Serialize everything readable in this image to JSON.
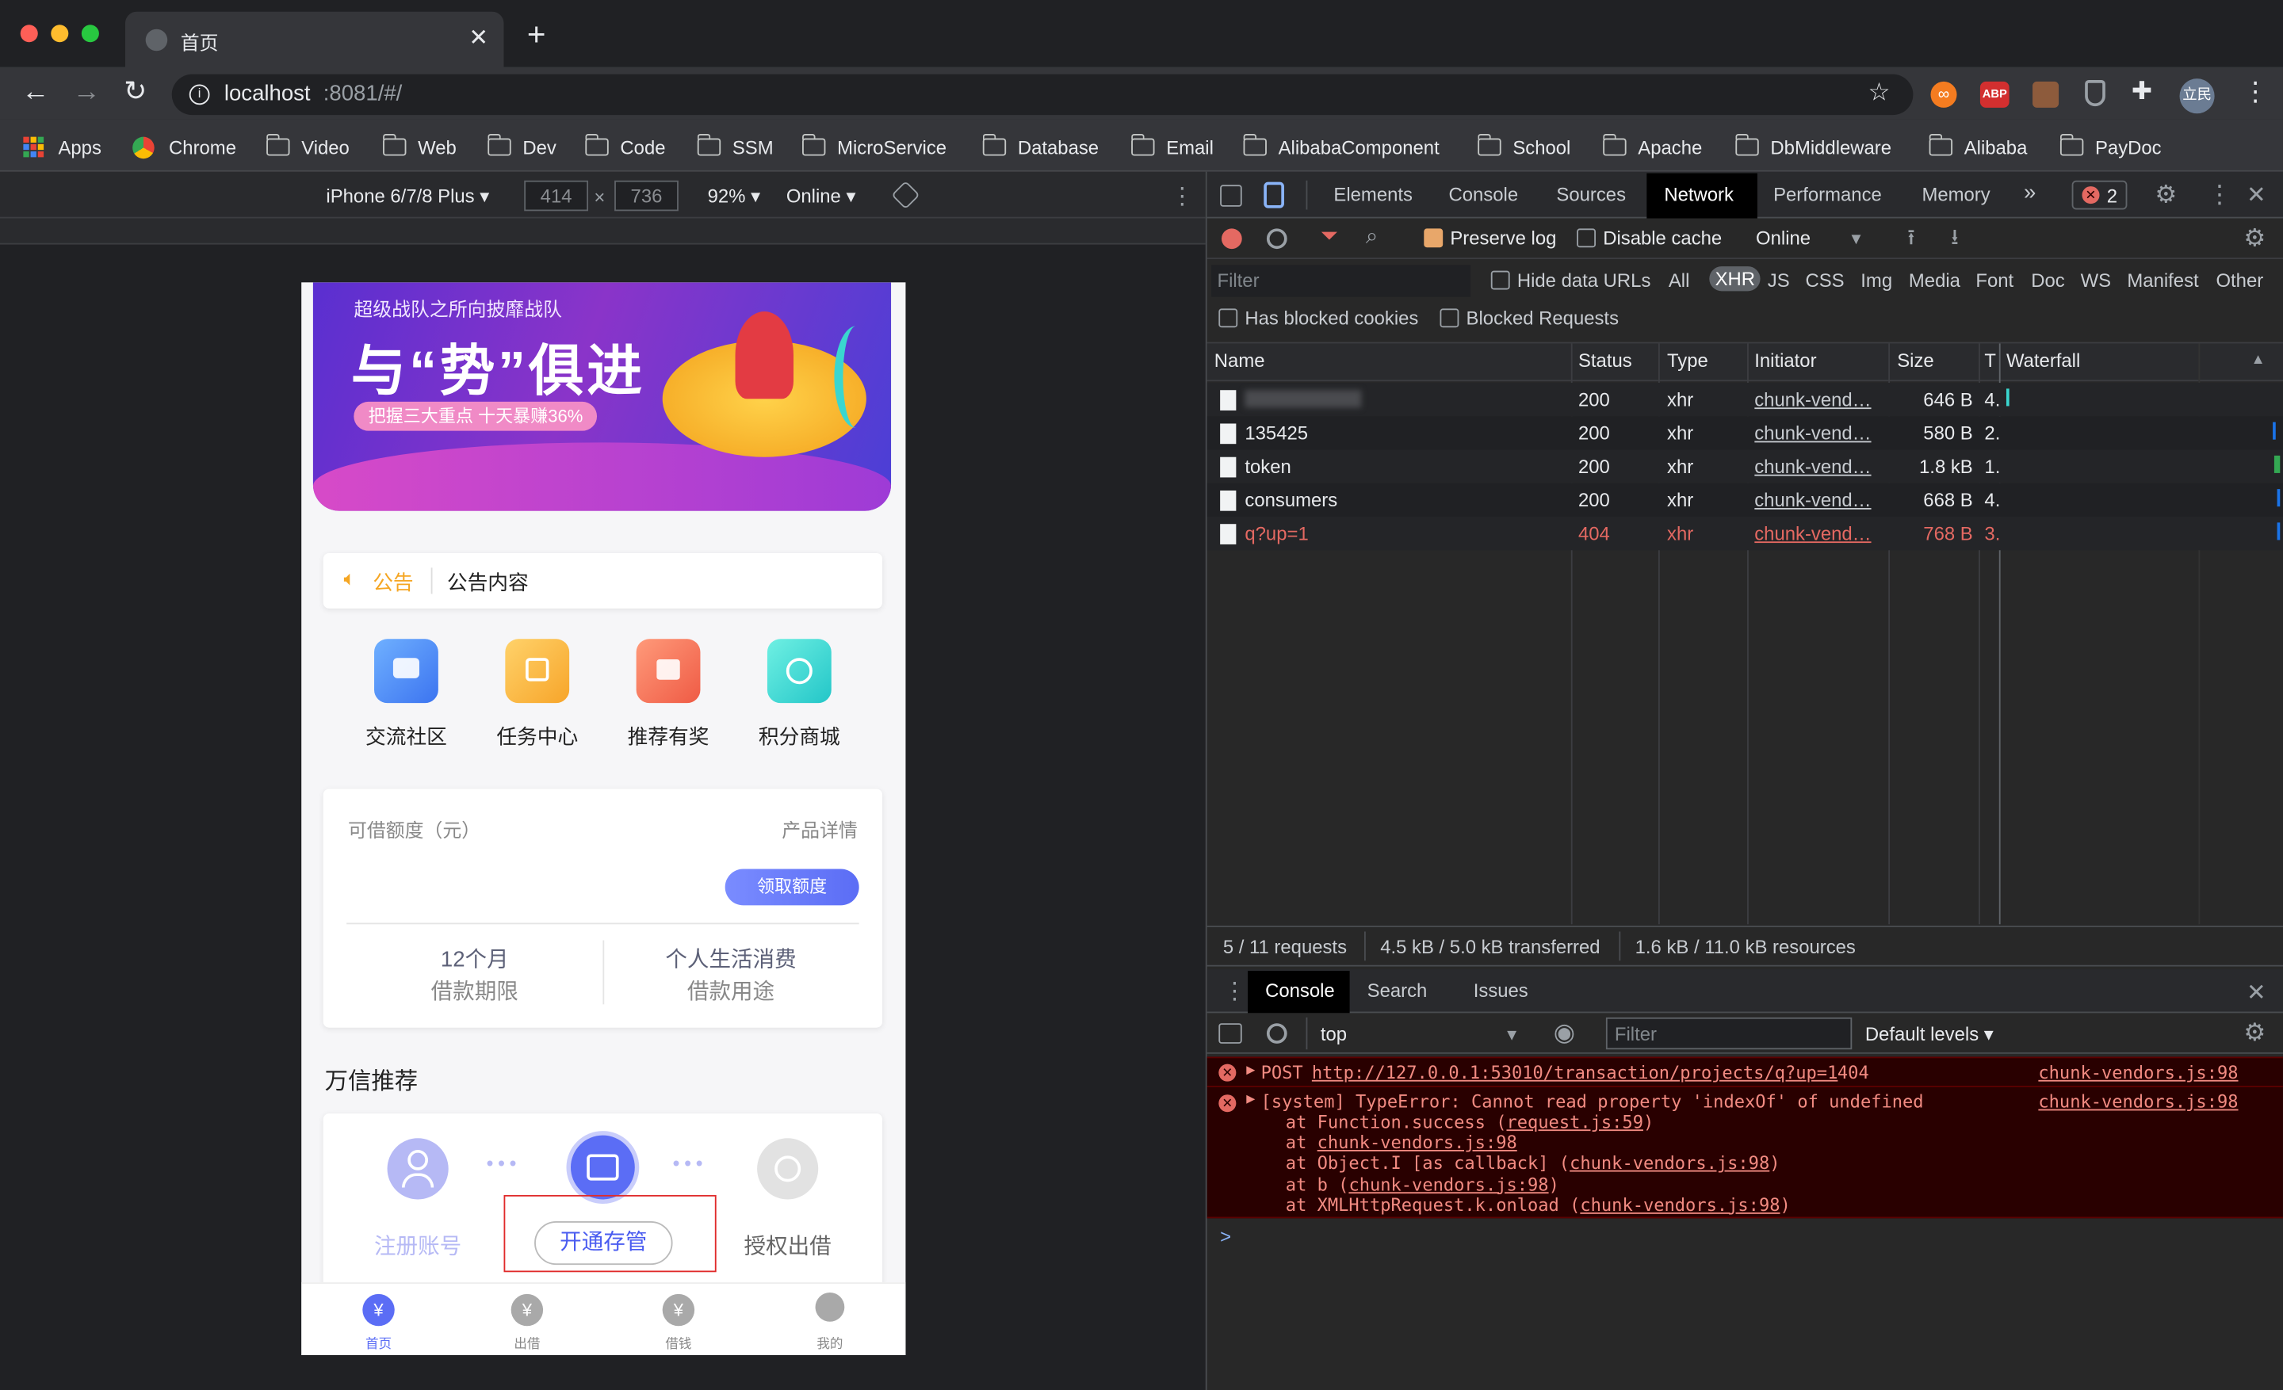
{
  "browser": {
    "tab_title": "首页",
    "url_host": "localhost",
    "url_rest": ":8081/#/",
    "bookmarks": [
      {
        "label": "Apps"
      },
      {
        "label": "Chrome"
      },
      {
        "label": "Video"
      },
      {
        "label": "Web"
      },
      {
        "label": "Dev"
      },
      {
        "label": "Code"
      },
      {
        "label": "SSM"
      },
      {
        "label": "MicroService"
      },
      {
        "label": "Database"
      },
      {
        "label": "Email"
      },
      {
        "label": "AlibabaComponent"
      },
      {
        "label": "School"
      },
      {
        "label": "Apache"
      },
      {
        "label": "DbMiddleware"
      },
      {
        "label": "Alibaba"
      },
      {
        "label": "PayDoc"
      }
    ],
    "profile_initials": "立民",
    "ext_abp": "ABP"
  },
  "device_bar": {
    "device": "iPhone 6/7/8 Plus",
    "width": "414",
    "height": "736",
    "x_sep": "×",
    "zoom": "92%",
    "throttle": "Online"
  },
  "app": {
    "banner": {
      "subtitle": "超级战队之所向披靡战队",
      "headline": "与“势”俱进",
      "tagline": "把握三大重点 十天暴赚36%"
    },
    "notice": {
      "label": "公告",
      "content": "公告内容"
    },
    "tiles": [
      {
        "label": "交流社区",
        "color": "#4c8cf5"
      },
      {
        "label": "任务中心",
        "color": "#f9b23a"
      },
      {
        "label": "推荐有奖",
        "color": "#f4714f"
      },
      {
        "label": "积分商城",
        "color": "#3ad6cf"
      }
    ],
    "credit": {
      "label": "可借额度（元）",
      "detail_link": "产品详情",
      "button": "领取额度",
      "term_value": "12个月",
      "term_label": "借款期限",
      "purpose_value": "个人生活消费",
      "purpose_label": "借款用途"
    },
    "recommend": {
      "title": "万信推荐",
      "steps": [
        {
          "label": "注册账号"
        },
        {
          "label": "开通存管"
        },
        {
          "label": "授权出借"
        }
      ]
    },
    "bottom_nav": [
      {
        "label": "首页"
      },
      {
        "label": "出借"
      },
      {
        "label": "借钱"
      },
      {
        "label": "我的"
      }
    ]
  },
  "devtools": {
    "tabs": [
      "Elements",
      "Console",
      "Sources",
      "Network",
      "Performance",
      "Memory",
      "»"
    ],
    "active_tab": "Network",
    "error_count": "2",
    "network_toolbar": {
      "preserve_log": "Preserve log",
      "disable_cache": "Disable cache",
      "throttle": "Online"
    },
    "filter": {
      "placeholder": "Filter",
      "hide_data_urls": "Hide data URLs",
      "types": [
        "All",
        "XHR",
        "JS",
        "CSS",
        "Img",
        "Media",
        "Font",
        "Doc",
        "WS",
        "Manifest",
        "Other"
      ],
      "has_blocked_cookies": "Has blocked cookies",
      "blocked_requests": "Blocked Requests"
    },
    "columns": {
      "name": "Name",
      "status": "Status",
      "type": "Type",
      "initiator": "Initiator",
      "size": "Size",
      "time": "T",
      "waterfall": "Waterfall"
    },
    "requests": [
      {
        "name": "",
        "status": "200",
        "type": "xhr",
        "initiator": "chunk-vend…",
        "size": "646 B",
        "time": "4."
      },
      {
        "name": "135425",
        "status": "200",
        "type": "xhr",
        "initiator": "chunk-vend…",
        "size": "580 B",
        "time": "2."
      },
      {
        "name": "token",
        "status": "200",
        "type": "xhr",
        "initiator": "chunk-vend…",
        "size": "1.8 kB",
        "time": "1."
      },
      {
        "name": "consumers",
        "status": "200",
        "type": "xhr",
        "initiator": "chunk-vend…",
        "size": "668 B",
        "time": "4."
      },
      {
        "name": "q?up=1",
        "status": "404",
        "type": "xhr",
        "initiator": "chunk-vend…",
        "size": "768 B",
        "time": "3."
      }
    ],
    "summary": {
      "requests": "5 / 11 requests",
      "transferred": "4.5 kB / 5.0 kB transferred",
      "resources": "1.6 kB / 11.0 kB resources"
    },
    "drawer_tabs": [
      "Console",
      "Search",
      "Issues"
    ],
    "console_toolbar": {
      "context": "top",
      "filter_placeholder": "Filter",
      "levels": "Default levels"
    },
    "messages": {
      "m1_prefix": "POST ",
      "m1_url": "http://127.0.0.1:53010/transaction/projects/q?up=1",
      "m1_suffix": " 404",
      "m1_source": "chunk-vendors.js:98",
      "m2_text": "[system] TypeError: Cannot read property 'indexOf' of undefined",
      "m2_source": "chunk-vendors.js:98",
      "stack": [
        {
          "pre": "at Function.success (",
          "link": "request.js:59",
          "post": ")"
        },
        {
          "pre": "at ",
          "link": "chunk-vendors.js:98",
          "post": ""
        },
        {
          "pre": "at Object.I [as callback] (",
          "link": "chunk-vendors.js:98",
          "post": ")"
        },
        {
          "pre": "at b (",
          "link": "chunk-vendors.js:98",
          "post": ")"
        },
        {
          "pre": "at XMLHttpRequest.k.onload (",
          "link": "chunk-vendors.js:98",
          "post": ")"
        }
      ]
    },
    "prompt": ">"
  }
}
